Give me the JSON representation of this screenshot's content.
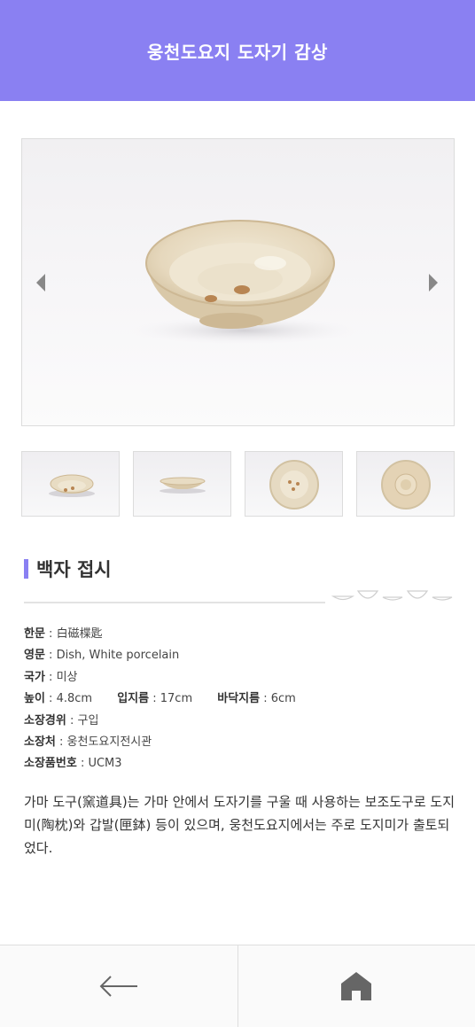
{
  "header": {
    "title": "웅천도요지 도자기 감상"
  },
  "gallery": {
    "prev_icon": "chevron-left-icon",
    "next_icon": "chevron-right-icon",
    "thumbnail_count": 4
  },
  "item": {
    "name": "백자 접시",
    "fields": {
      "hanmun_label": "한문",
      "hanmun_value": "白磁楪匙",
      "english_label": "영문",
      "english_value": "Dish, White porcelain",
      "country_label": "국가",
      "country_value": "미상",
      "height_label": "높이",
      "height_value": "4.8cm",
      "mouth_label": "입지름",
      "mouth_value": "17cm",
      "base_label": "바닥지름",
      "base_value": "6cm",
      "acquisition_label": "소장경위",
      "acquisition_value": "구입",
      "location_label": "소장처",
      "location_value": "웅천도요지전시관",
      "number_label": "소장품번호",
      "number_value": "UCM3"
    },
    "description": "가마 도구(窯道具)는 가마 안에서 도자기를 구울 때 사용하는 보조도구로 도지미(陶枕)와 갑발(匣鉢) 등이 있으며, 웅천도요지에서는 주로 도지미가 출토되었다."
  },
  "nav": {
    "back_icon": "arrow-left-icon",
    "home_icon": "home-icon"
  },
  "colors": {
    "accent": "#8a80f2",
    "glaze": "#e9dcc3",
    "spot": "#b88552"
  }
}
